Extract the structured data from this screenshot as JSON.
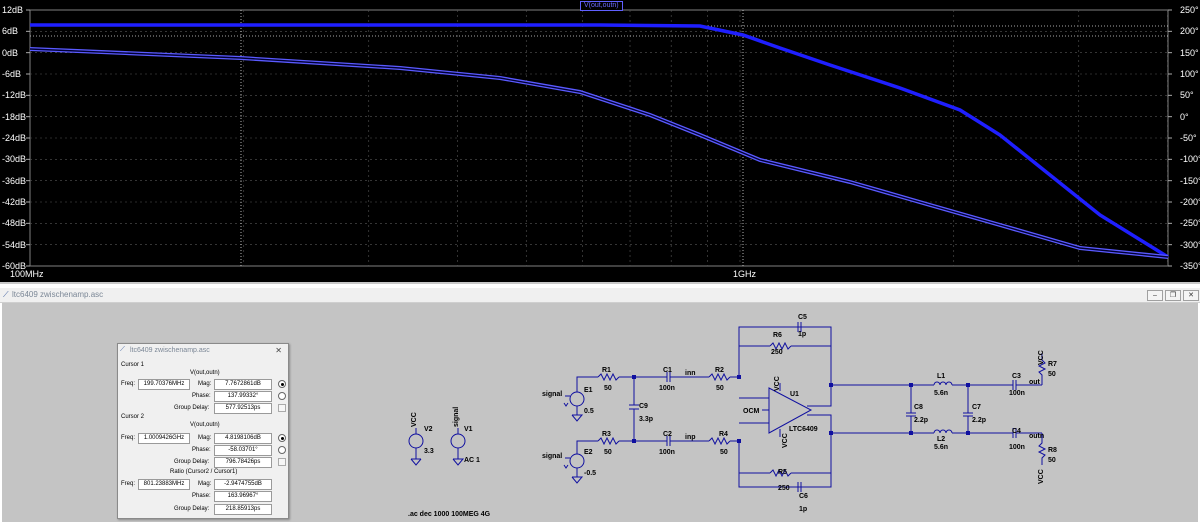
{
  "plot": {
    "trace_label": "V(out,outn)",
    "y_left_ticks": [
      "12dB",
      "6dB",
      "0dB",
      "-6dB",
      "-12dB",
      "-18dB",
      "-24dB",
      "-30dB",
      "-36dB",
      "-42dB",
      "-48dB",
      "-54dB",
      "-60dB"
    ],
    "y_right_ticks": [
      "250°",
      "200°",
      "150°",
      "100°",
      "50°",
      "0°",
      "-50°",
      "-100°",
      "-150°",
      "-200°",
      "-250°",
      "-300°",
      "-350°"
    ],
    "x_ticks": [
      "100MHz",
      "1GHz"
    ],
    "colors": {
      "background": "#000000",
      "trace": "#1f1fff",
      "grid": "#555555"
    }
  },
  "window": {
    "title": "ltc6409 zwischenamp.asc",
    "buttons": [
      "minimize",
      "restore",
      "close"
    ]
  },
  "cursor_dialog": {
    "title": "ltc6409 zwischenamp.asc",
    "cursor1": {
      "heading": "Cursor 1",
      "trace": "V(out,outn)",
      "freq_label": "Freq:",
      "freq": "199.70376MHz",
      "mag_label": "Mag:",
      "mag": "7.7672861dB",
      "phase_label": "Phase:",
      "phase": "137.99332°",
      "gd_label": "Group Delay:",
      "gd": "577.92513ps"
    },
    "cursor2": {
      "heading": "Cursor 2",
      "trace": "V(out,outn)",
      "freq_label": "Freq:",
      "freq": "1.0009426GHz",
      "mag_label": "Mag:",
      "mag": "4.8198106dB",
      "phase_label": "Phase:",
      "phase": "-58.03701°",
      "gd_label": "Group Delay:",
      "gd": "796.78426ps"
    },
    "ratio": {
      "heading": "Ratio (Cursor2 / Cursor1)",
      "freq_label": "Freq:",
      "freq": "801.23883MHz",
      "mag_label": "Mag:",
      "mag": "-2.9474755dB",
      "phase_label": "Phase:",
      "phase": "163.96967°",
      "gd_label": "Group Delay:",
      "gd": "218.85913ps"
    }
  },
  "schematic": {
    "spice_directive": ".ac dec 1000 100MEG 4G",
    "labels": {
      "vcc": "VCC",
      "signal": "signal",
      "v2": "V2",
      "v2_val": "3.3",
      "v1": "V1",
      "v1_val": "AC 1",
      "e1": "E1",
      "e1_val": "0.5",
      "e2": "E2",
      "e2_val": "-0.5",
      "r1": "R1",
      "r1_val": "50",
      "r3": "R3",
      "r3_val": "50",
      "c1": "C1",
      "c1_val": "100n",
      "c2": "C2",
      "c2_val": "100n",
      "c9": "C9",
      "c9_val": "3.3p",
      "inn": "inn",
      "inp": "inp",
      "r2": "R2",
      "r2_val": "50",
      "r4": "R4",
      "r4_val": "50",
      "r6": "R6",
      "r6_val": "250",
      "c5": "C5",
      "c5_val": "1p",
      "r5": "R5",
      "r5_val": "250",
      "c6": "C6",
      "c6_val": "1p",
      "ocm": "OCM",
      "u1": "U1",
      "u1_part": "LTC6409",
      "c8": "C8",
      "c8_val": "2.2p",
      "c7": "C7",
      "c7_val": "2.2p",
      "l1": "L1",
      "l1_val": "5.6n",
      "l2": "L2",
      "l2_val": "5.6n",
      "c3": "C3",
      "c3_val": "100n",
      "c4": "C4",
      "c4_val": "100n",
      "out": "out",
      "outn": "outn",
      "r7": "R7",
      "r7_val": "50",
      "r8": "R8",
      "r8_val": "50"
    }
  }
}
